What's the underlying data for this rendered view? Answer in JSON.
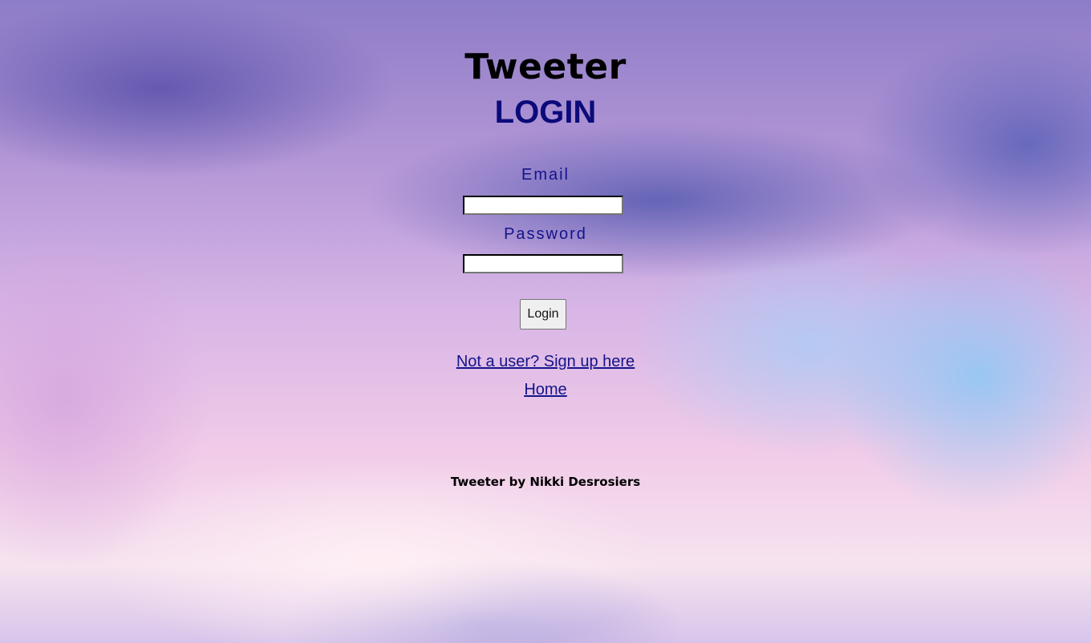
{
  "app": {
    "title": "Tweeter"
  },
  "login": {
    "heading": "LOGIN",
    "email_label": "Email",
    "email_value": "",
    "password_label": "Password",
    "password_value": "",
    "submit_label": "Login"
  },
  "links": {
    "signup": "Not a user? Sign up here",
    "home": "Home"
  },
  "footer": {
    "credit": "Tweeter by Nikki Desrosiers"
  },
  "colors": {
    "heading": "#0b0b7a",
    "label": "#14148a"
  }
}
